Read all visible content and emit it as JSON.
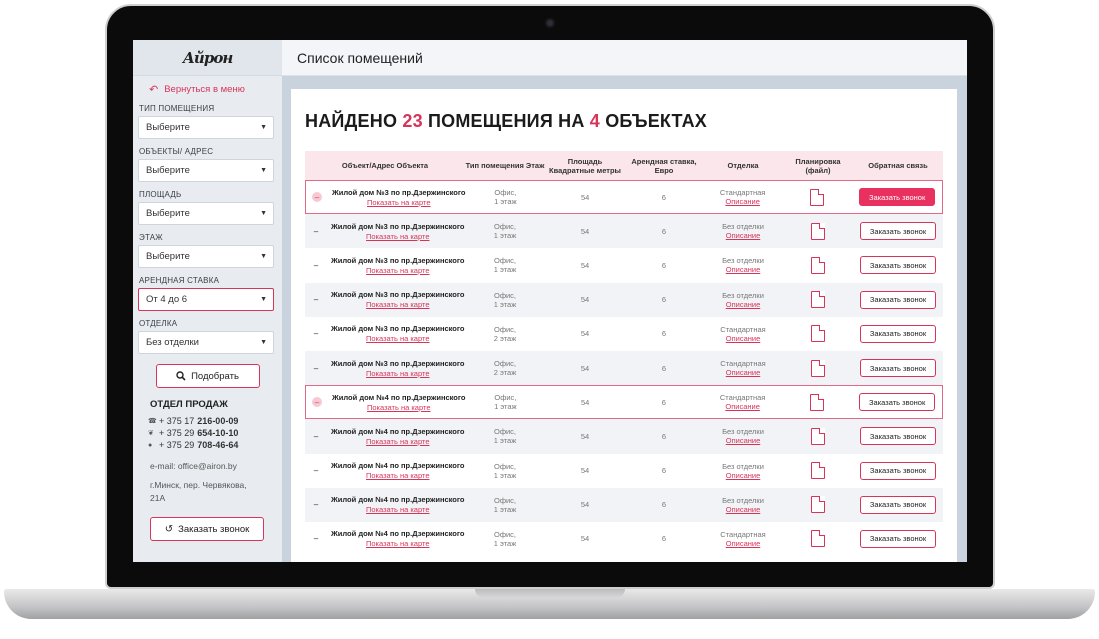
{
  "sidebar": {
    "logo": "Айрон",
    "back": "Вернуться в меню",
    "filters": [
      {
        "label": "Тип помещения",
        "value": "Выберите"
      },
      {
        "label": "Объекты/ адрес",
        "value": "Выберите"
      },
      {
        "label": "Площадь",
        "value": "Выберите"
      },
      {
        "label": "Этаж",
        "value": "Выберите"
      },
      {
        "label": "Арендная ставка",
        "value": "От 4 до 6"
      },
      {
        "label": "Отделка",
        "value": "Без отделки"
      }
    ],
    "search_button": "Подобрать",
    "sales_title": "ОТДЕЛ ПРОДАЖ",
    "phones": [
      {
        "prefix": "+ 375 17",
        "number": "216-00-09"
      },
      {
        "prefix": "+ 375 29",
        "number": "654-10-10"
      },
      {
        "prefix": "+ 375 29",
        "number": "708-46-64"
      }
    ],
    "email": "e-mail: office@airon.by",
    "address": "г.Минск, пер. Червякова, 21А",
    "callback_button": "Заказать звонок"
  },
  "header": {
    "title": "Список помещений"
  },
  "result": {
    "prefix": "НАЙДЕНО",
    "count": "23",
    "middle": "ПОМЕЩЕНИЯ НА",
    "objects": "4",
    "suffix": "ОБЪЕКТАХ"
  },
  "table": {
    "headers": [
      "Объект/Адрес Объекта",
      "Тип помещения Этаж",
      "Площадь Квадратные метры",
      "Арендная ставка, Евро",
      "Отделка",
      "Планировка (файл)",
      "Обратная связь"
    ],
    "map_label": "Показать на карте",
    "desc_label": "Описание",
    "call_label": "Заказать звонок",
    "rows": [
      {
        "name": "Жилой дом №3 по пр.Дзержинского",
        "type": "Офис,",
        "floor": "1 этаж",
        "area": "54",
        "rate": "6",
        "finish": "Стандартная"
      },
      {
        "name": "Жилой дом №3 по пр.Дзержинского",
        "type": "Офис,",
        "floor": "1 этаж",
        "area": "54",
        "rate": "6",
        "finish": "Без отделки"
      },
      {
        "name": "Жилой дом №3 по пр.Дзержинского",
        "type": "Офис,",
        "floor": "1 этаж",
        "area": "54",
        "rate": "6",
        "finish": "Без отделки"
      },
      {
        "name": "Жилой дом №3 по пр.Дзержинского",
        "type": "Офис,",
        "floor": "1 этаж",
        "area": "54",
        "rate": "6",
        "finish": "Без отделки"
      },
      {
        "name": "Жилой дом №3 по пр.Дзержинского",
        "type": "Офис,",
        "floor": "2 этаж",
        "area": "54",
        "rate": "6",
        "finish": "Стандартная"
      },
      {
        "name": "Жилой дом №3 по пр.Дзержинского",
        "type": "Офис,",
        "floor": "2 этаж",
        "area": "54",
        "rate": "6",
        "finish": "Стандартная"
      },
      {
        "name": "Жилой дом №4 по пр.Дзержинского",
        "type": "Офис,",
        "floor": "1 этаж",
        "area": "54",
        "rate": "6",
        "finish": "Стандартная"
      },
      {
        "name": "Жилой дом №4 по пр.Дзержинского",
        "type": "Офис,",
        "floor": "1 этаж",
        "area": "54",
        "rate": "6",
        "finish": "Без отделки"
      },
      {
        "name": "Жилой дом №4 по пр.Дзержинского",
        "type": "Офис,",
        "floor": "1 этаж",
        "area": "54",
        "rate": "6",
        "finish": "Без отделки"
      },
      {
        "name": "Жилой дом №4 по пр.Дзержинского",
        "type": "Офис,",
        "floor": "1 этаж",
        "area": "54",
        "rate": "6",
        "finish": "Без отделки"
      },
      {
        "name": "Жилой дом №4 по пр.Дзержинского",
        "type": "Офис,",
        "floor": "1 этаж",
        "area": "54",
        "rate": "6",
        "finish": "Стандартная"
      }
    ]
  },
  "colors": {
    "accent": "#d7345a",
    "header_bg": "#fbe6ec"
  }
}
